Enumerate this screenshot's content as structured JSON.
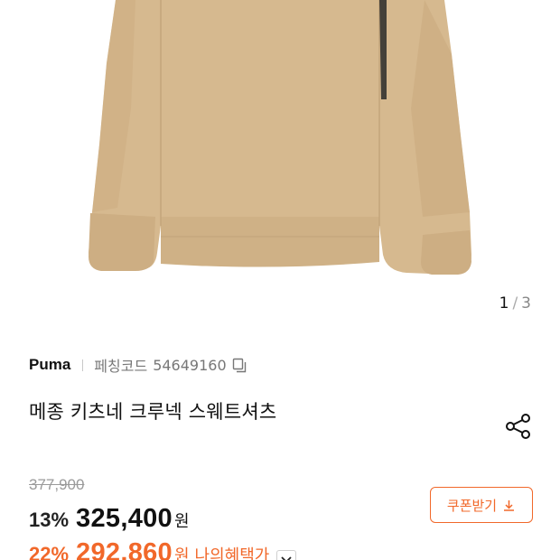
{
  "image_gallery": {
    "current": "1",
    "separator": "/",
    "total": "3",
    "image_subject": "beige crew neck sweatshirt",
    "sweatshirt_color": "#d6b98f"
  },
  "product": {
    "brand": "Puma",
    "code_label": "페칭코드",
    "code_number": "54649160",
    "title": "메종 키츠네 크루넥 스웨트셔츠"
  },
  "pricing": {
    "original_price": "377,900",
    "discount_rate": "13%",
    "sale_price": "325,400",
    "currency": "원",
    "best_discount_rate": "22%",
    "best_price": "292,860",
    "best_currency": "원",
    "best_label": "나의혜택가"
  },
  "coupon": {
    "label": "쿠폰받기"
  },
  "icons": {
    "copy": "copy-icon",
    "share": "share-icon",
    "download": "download-icon",
    "chevron": "chevron-down-icon"
  },
  "colors": {
    "accent": "#f1682a",
    "muted": "#9a9a9a",
    "text": "#111111"
  }
}
